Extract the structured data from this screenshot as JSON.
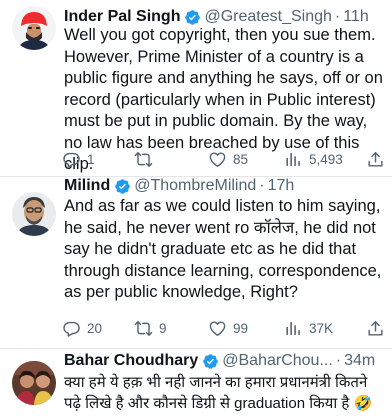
{
  "tweets": [
    {
      "name": "Inder Pal Singh",
      "handle": "@Greatest_Singh",
      "separator": "·",
      "time": "11h",
      "text": "Well you got copyright, then you sue them. However, Prime Minister of a country is a public figure and anything he says, off or on record (particularly when in Public interest) must be put in public domain. By the way, no law has been breached by use of this clip.",
      "replies": "1",
      "retweets": "",
      "likes": "85",
      "views": "5,493"
    },
    {
      "name": "Milind",
      "handle": "@ThombreMilind",
      "separator": "·",
      "time": "17h",
      "text": "And as far as we could listen to him saying, he said, he never went ro कॉलेज, he did not say he didn't graduate etc as he did that through distance learning, correspondence, as per public knowledge, Right?",
      "replies": "20",
      "retweets": "9",
      "likes": "99",
      "views": "37K"
    },
    {
      "name": "Bahar Choudhary",
      "handle": "@BaharChou...",
      "separator": "·",
      "time": "34m",
      "text": "क्या हमे ये हक़ भी नही जानने का हमारा प्रधानमंत्री कितने पढ़े लिखे है और कौनसे डिग्री से graduation किया है 🤣"
    }
  ],
  "icons": {
    "verified": "verified-badge-icon",
    "reply": "reply-icon",
    "retweet": "retweet-icon",
    "like": "like-icon",
    "views": "views-icon",
    "share": "share-icon"
  },
  "colors": {
    "verified": "#1d9bf0",
    "text": "#0f1419",
    "muted": "#536471",
    "divider": "#e6e6e6"
  }
}
